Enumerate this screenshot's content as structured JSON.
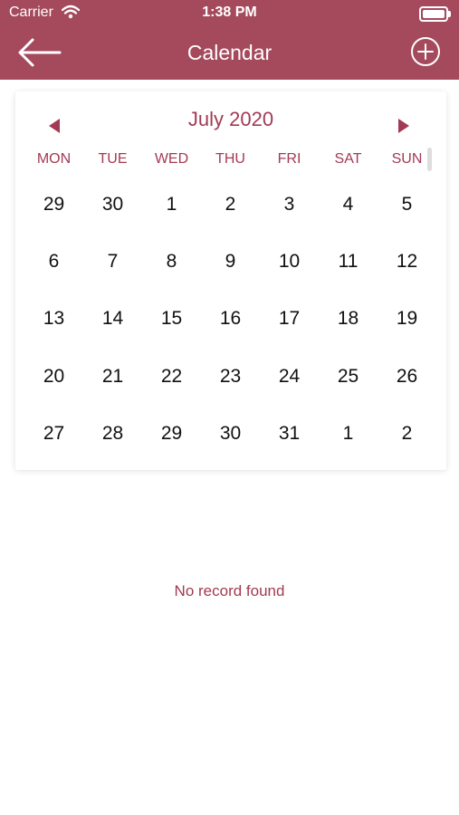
{
  "status_bar": {
    "carrier": "Carrier",
    "time": "1:38 PM"
  },
  "header": {
    "title": "Calendar",
    "back_icon": "arrow-left-icon",
    "add_icon": "plus-circle-icon"
  },
  "calendar": {
    "month_label": "July 2020",
    "weekdays": [
      "MON",
      "TUE",
      "WED",
      "THU",
      "FRI",
      "SAT",
      "SUN"
    ],
    "weeks": [
      [
        "29",
        "30",
        "1",
        "2",
        "3",
        "4",
        "5"
      ],
      [
        "6",
        "7",
        "8",
        "9",
        "10",
        "11",
        "12"
      ],
      [
        "13",
        "14",
        "15",
        "16",
        "17",
        "18",
        "19"
      ],
      [
        "20",
        "21",
        "22",
        "23",
        "24",
        "25",
        "26"
      ],
      [
        "27",
        "28",
        "29",
        "30",
        "31",
        "1",
        "2"
      ]
    ]
  },
  "empty_state": {
    "message": "No record found"
  },
  "colors": {
    "header": "#a44a5c",
    "accent": "#a33a54",
    "text": "#111111",
    "background": "#ffffff"
  }
}
